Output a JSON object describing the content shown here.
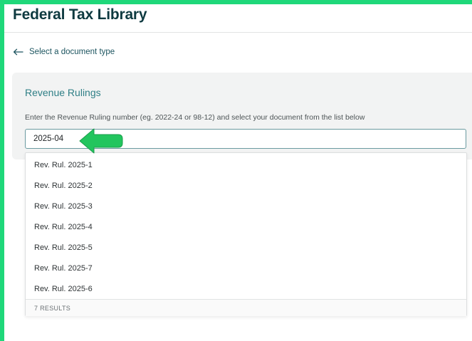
{
  "header": {
    "title": "Federal Tax Library"
  },
  "nav": {
    "back_label": "Select a document type"
  },
  "section": {
    "title": "Revenue Rulings",
    "instructions": "Enter the Revenue Ruling number (eg. 2022-24 or 98-12) and select your document from the list below"
  },
  "search": {
    "value": "2025-04"
  },
  "results": {
    "items": [
      {
        "label": "Rev. Rul. 2025-1"
      },
      {
        "label": "Rev. Rul. 2025-2"
      },
      {
        "label": "Rev. Rul. 2025-3"
      },
      {
        "label": "Rev. Rul. 2025-4"
      },
      {
        "label": "Rev. Rul. 2025-5"
      },
      {
        "label": "Rev. Rul. 2025-7"
      },
      {
        "label": "Rev. Rul. 2025-6"
      }
    ],
    "count_label": "7 RESULTS"
  },
  "colors": {
    "frame": "#1fd87a",
    "title": "#0e3a40",
    "accent": "#2f7f86",
    "annotation_arrow": "#22c55e"
  },
  "icons": {
    "back": "arrow-left-icon",
    "annotation": "pointer-arrow-icon"
  }
}
